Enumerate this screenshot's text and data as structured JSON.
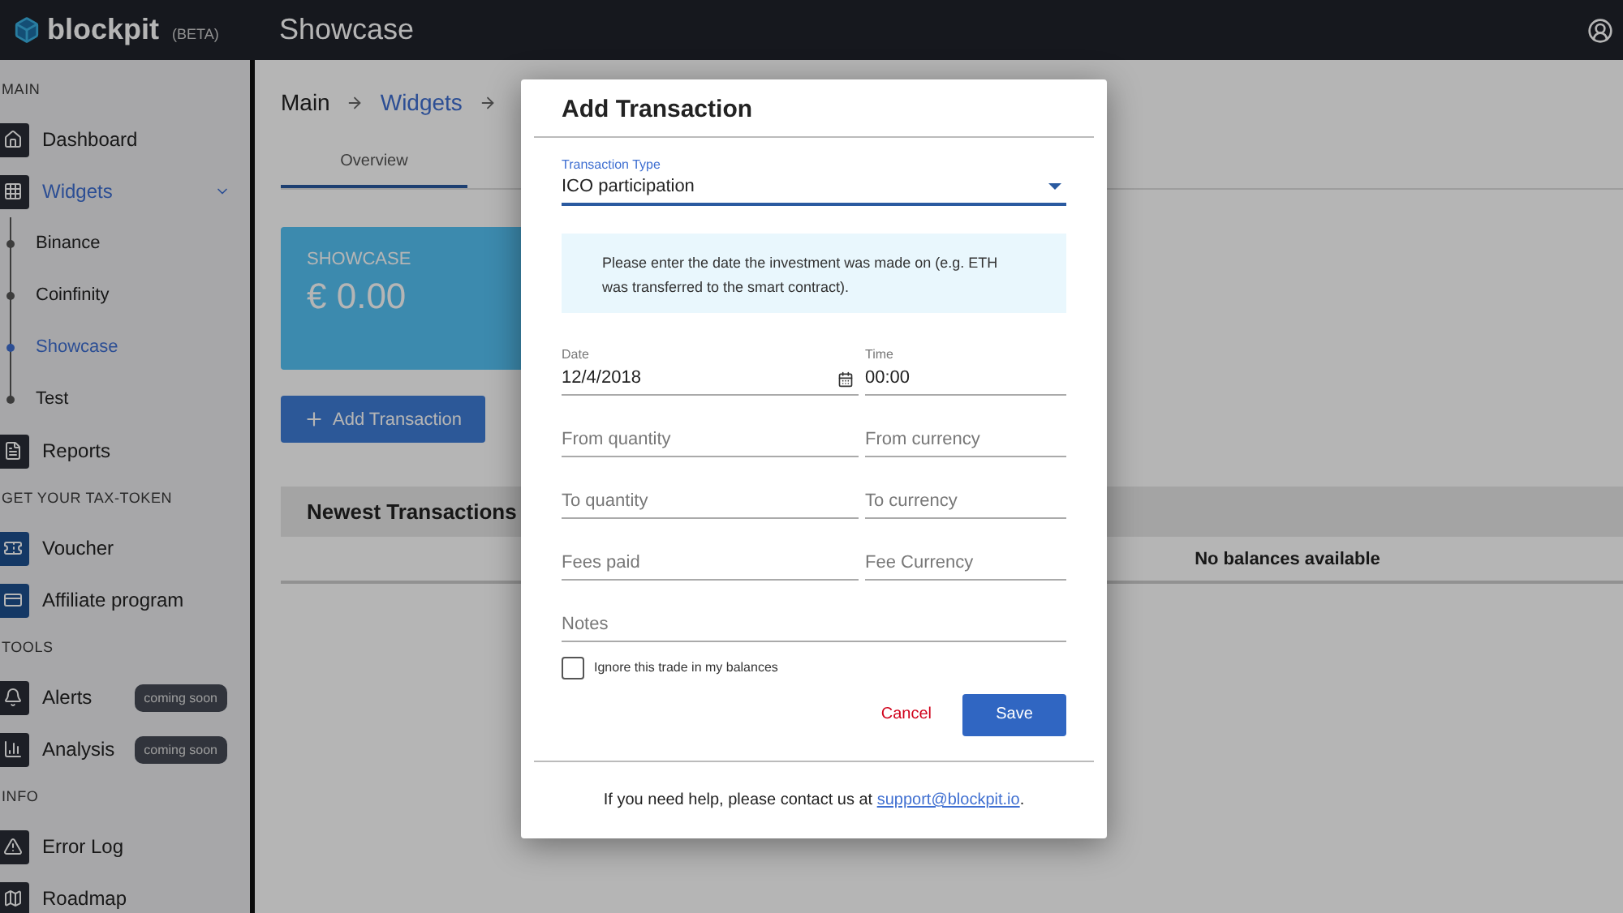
{
  "header": {
    "logo": "blockpit",
    "badge": "(BETA)",
    "title": "Showcase"
  },
  "sidebar": {
    "sections": [
      {
        "title": "MAIN",
        "items": [
          {
            "label": "Dashboard",
            "selected": false
          },
          {
            "label": "Widgets",
            "selected": true,
            "expanded": true,
            "children": [
              {
                "label": "Binance",
                "selected": false
              },
              {
                "label": "Coinfinity",
                "selected": false
              },
              {
                "label": "Showcase",
                "selected": true
              },
              {
                "label": "Test",
                "selected": false
              }
            ]
          },
          {
            "label": "Reports",
            "selected": false
          }
        ]
      },
      {
        "title": "GET YOUR TAX-TOKEN",
        "items": [
          {
            "label": "Voucher",
            "selected": false
          },
          {
            "label": "Affiliate program",
            "selected": false
          }
        ]
      },
      {
        "title": "TOOLS",
        "items": [
          {
            "label": "Alerts",
            "selected": false,
            "badge": "coming soon"
          },
          {
            "label": "Analysis",
            "selected": false,
            "badge": "coming soon"
          }
        ]
      },
      {
        "title": "INFO",
        "items": [
          {
            "label": "Error Log",
            "selected": false
          },
          {
            "label": "Roadmap",
            "selected": false
          }
        ]
      }
    ]
  },
  "breadcrumb": [
    {
      "label": "Main",
      "link": false
    },
    {
      "label": "Widgets",
      "link": true
    }
  ],
  "tabs": [
    {
      "label": "Overview",
      "selected": true
    }
  ],
  "card": {
    "title": "SHOWCASE",
    "value": "€ 0.00"
  },
  "add_button": "Add Transaction",
  "table": {
    "title": "Newest Transactions",
    "cells": [
      "No balances available"
    ]
  },
  "dialog": {
    "title": "Add Transaction",
    "transaction_type": {
      "label": "Transaction Type",
      "value": "ICO participation"
    },
    "info": "Please enter the date the investment was made on (e.g. ETH was transferred to the smart contract).",
    "fields": [
      {
        "kind": "date",
        "label": "Date",
        "value": "12/4/2018"
      },
      {
        "kind": "value",
        "label": "Time",
        "value": "00:00"
      },
      {
        "kind": "empty",
        "placeholder": "From quantity"
      },
      {
        "kind": "empty",
        "placeholder": "From currency"
      },
      {
        "kind": "empty",
        "placeholder": "To quantity"
      },
      {
        "kind": "empty",
        "placeholder": "To currency"
      },
      {
        "kind": "empty",
        "placeholder": "Fees paid"
      },
      {
        "kind": "empty",
        "placeholder": "Fee Currency"
      },
      {
        "kind": "wide",
        "placeholder": "Notes"
      }
    ],
    "checkbox": {
      "label": "Ignore this trade in my balances",
      "checked": false
    },
    "cancel": "Cancel",
    "save": "Save",
    "help": {
      "text": "If you need help, please contact us at ",
      "link": "support@blockpit.io",
      "after": "."
    }
  }
}
